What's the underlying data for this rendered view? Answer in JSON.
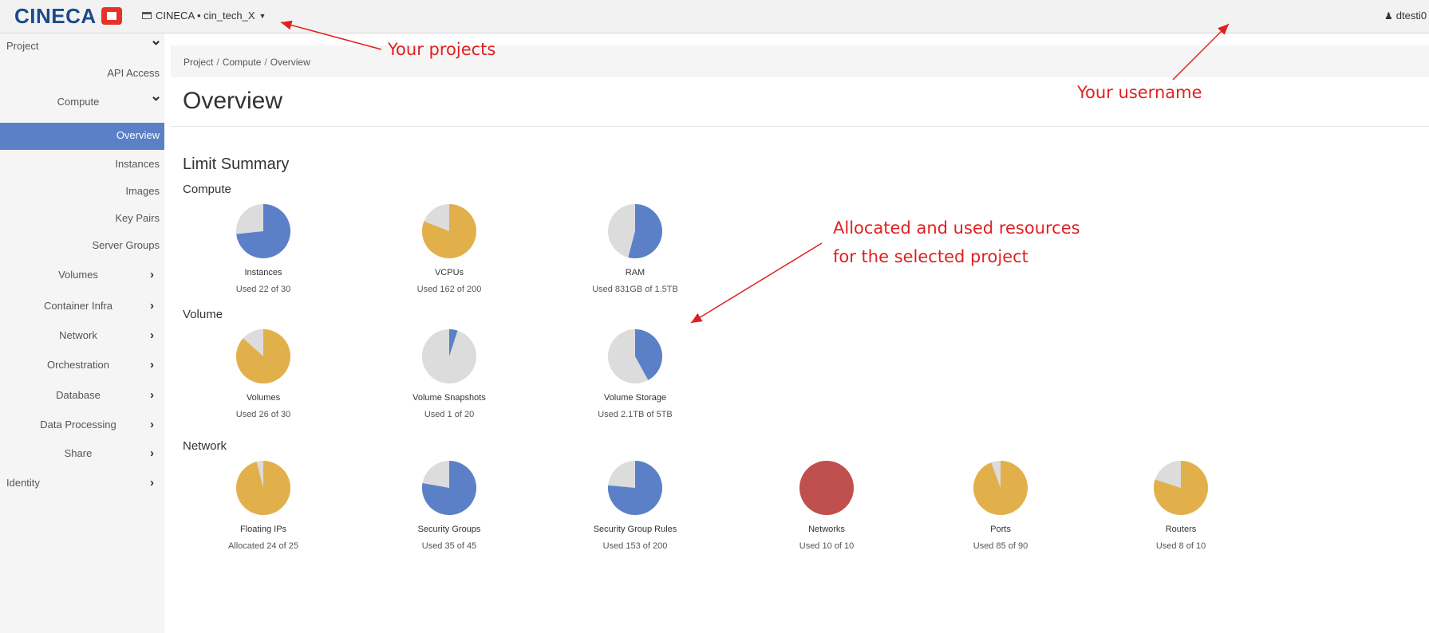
{
  "header": {
    "logo_text": "CINECA",
    "project_selector": "CINECA • cin_tech_X",
    "username": "dtesti0"
  },
  "sidebar": {
    "items": [
      {
        "label": "Project",
        "chevron": "⌄",
        "level": 0
      },
      {
        "label": "API Access",
        "chevron": "",
        "level": 1
      },
      {
        "label": "Compute",
        "chevron": "⌄",
        "level": 1
      },
      {
        "label": "Overview",
        "chevron": "",
        "level": 2,
        "active": true
      },
      {
        "label": "Instances",
        "chevron": "",
        "level": 2
      },
      {
        "label": "Images",
        "chevron": "",
        "level": 2
      },
      {
        "label": "Key Pairs",
        "chevron": "",
        "level": 2
      },
      {
        "label": "Server Groups",
        "chevron": "",
        "level": 2
      },
      {
        "label": "Volumes",
        "chevron": "›",
        "level": 1
      },
      {
        "label": "Container Infra",
        "chevron": "›",
        "level": 1
      },
      {
        "label": "Network",
        "chevron": "›",
        "level": 1
      },
      {
        "label": "Orchestration",
        "chevron": "›",
        "level": 1
      },
      {
        "label": "Database",
        "chevron": "›",
        "level": 1
      },
      {
        "label": "Data Processing",
        "chevron": "›",
        "level": 1
      },
      {
        "label": "Share",
        "chevron": "›",
        "level": 1
      },
      {
        "label": "Identity",
        "chevron": "›",
        "level": 0
      }
    ]
  },
  "breadcrumb": [
    "Project",
    "Compute",
    "Overview"
  ],
  "page_title": "Overview",
  "limit_summary": {
    "title": "Limit Summary",
    "groups": [
      {
        "title": "Compute",
        "items": [
          {
            "label": "Instances",
            "usage": "Used 22 of 30",
            "fraction": 0.733,
            "color": "#5b80c7"
          },
          {
            "label": "VCPUs",
            "usage": "Used 162 of 200",
            "fraction": 0.81,
            "color": "#e2b04b"
          },
          {
            "label": "RAM",
            "usage": "Used 831GB of 1.5TB",
            "fraction": 0.541,
            "color": "#5b80c7"
          }
        ]
      },
      {
        "title": "Volume",
        "items": [
          {
            "label": "Volumes",
            "usage": "Used 26 of 30",
            "fraction": 0.867,
            "color": "#e2b04b"
          },
          {
            "label": "Volume Snapshots",
            "usage": "Used 1 of 20",
            "fraction": 0.05,
            "color": "#5b80c7"
          },
          {
            "label": "Volume Storage",
            "usage": "Used 2.1TB of 5TB",
            "fraction": 0.42,
            "color": "#5b80c7"
          }
        ]
      },
      {
        "title": "Network",
        "items": [
          {
            "label": "Floating IPs",
            "usage": "Allocated 24 of 25",
            "fraction": 0.96,
            "color": "#e2b04b"
          },
          {
            "label": "Security Groups",
            "usage": "Used 35 of 45",
            "fraction": 0.778,
            "color": "#5b80c7"
          },
          {
            "label": "Security Group Rules",
            "usage": "Used 153 of 200",
            "fraction": 0.765,
            "color": "#5b80c7"
          },
          {
            "label": "Networks",
            "usage": "Used 10 of 10",
            "fraction": 1.0,
            "color": "#c0504d"
          },
          {
            "label": "Ports",
            "usage": "Used 85 of 90",
            "fraction": 0.944,
            "color": "#e2b04b"
          },
          {
            "label": "Routers",
            "usage": "Used 8 of 10",
            "fraction": 0.8,
            "color": "#e2b04b"
          }
        ]
      }
    ]
  },
  "annotations": {
    "projects": "Your projects",
    "username": "Your username",
    "resources_line1": "Allocated and used resources",
    "resources_line2": "for the selected project"
  },
  "colors": {
    "pie_empty": "#dcdcdc",
    "annotation": "#e02020",
    "active_nav": "#5b80c7"
  }
}
